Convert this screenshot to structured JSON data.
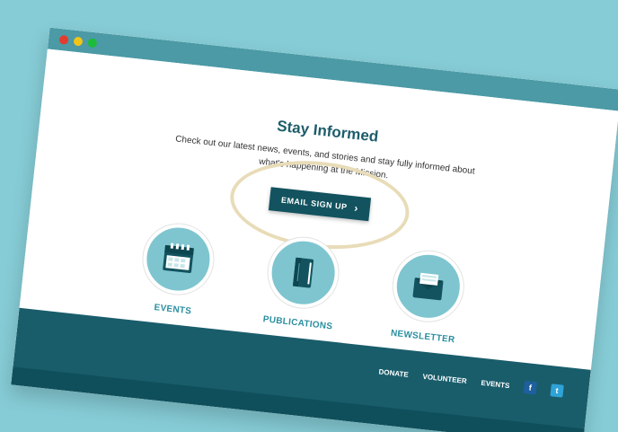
{
  "window": {
    "controls": [
      "close",
      "minimize",
      "maximize"
    ]
  },
  "hero": {
    "title": "Stay Informed",
    "description": "Check out our latest news, events, and stories and stay fully informed about what's happening at the Mission.",
    "cta": {
      "label": "EMAIL SIGN UP",
      "icon": "chevron-right-icon"
    }
  },
  "features": [
    {
      "label": "EVENTS",
      "icon": "calendar-icon"
    },
    {
      "label": "PUBLICATIONS",
      "icon": "book-icon"
    },
    {
      "label": "NEWSLETTER",
      "icon": "envelope-icon"
    }
  ],
  "footer": {
    "links": [
      "DONATE",
      "VOLUNTEER",
      "EVENTS"
    ],
    "social": [
      {
        "name": "facebook-icon",
        "glyph": "f"
      },
      {
        "name": "twitter-icon",
        "glyph": "t"
      }
    ]
  },
  "colors": {
    "background": "#86ccd6",
    "titlebar": "#4b9aa6",
    "primary": "#12535f",
    "accent": "#2a8ea0",
    "highlight": "#e8dcb8"
  }
}
